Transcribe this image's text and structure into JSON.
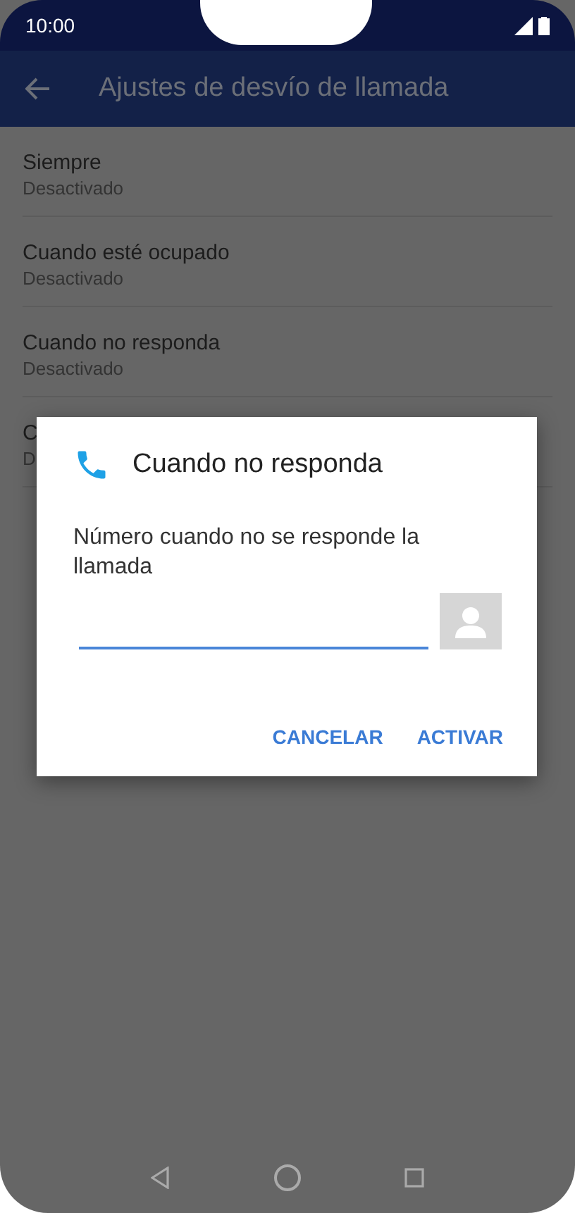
{
  "status_bar": {
    "time": "10:00"
  },
  "toolbar": {
    "title": "Ajustes de desvío de llamada"
  },
  "settings": [
    {
      "title": "Siempre",
      "subtitle": "Desactivado"
    },
    {
      "title": "Cuando esté ocupado",
      "subtitle": "Desactivado"
    },
    {
      "title": "Cuando no responda",
      "subtitle": "Desactivado"
    },
    {
      "title": "C",
      "subtitle": "D"
    }
  ],
  "dialog": {
    "title": "Cuando no responda",
    "message": "Número cuando no se responde la llamada",
    "buttons": [
      "CANCELAR",
      "ACTIVAR"
    ]
  }
}
